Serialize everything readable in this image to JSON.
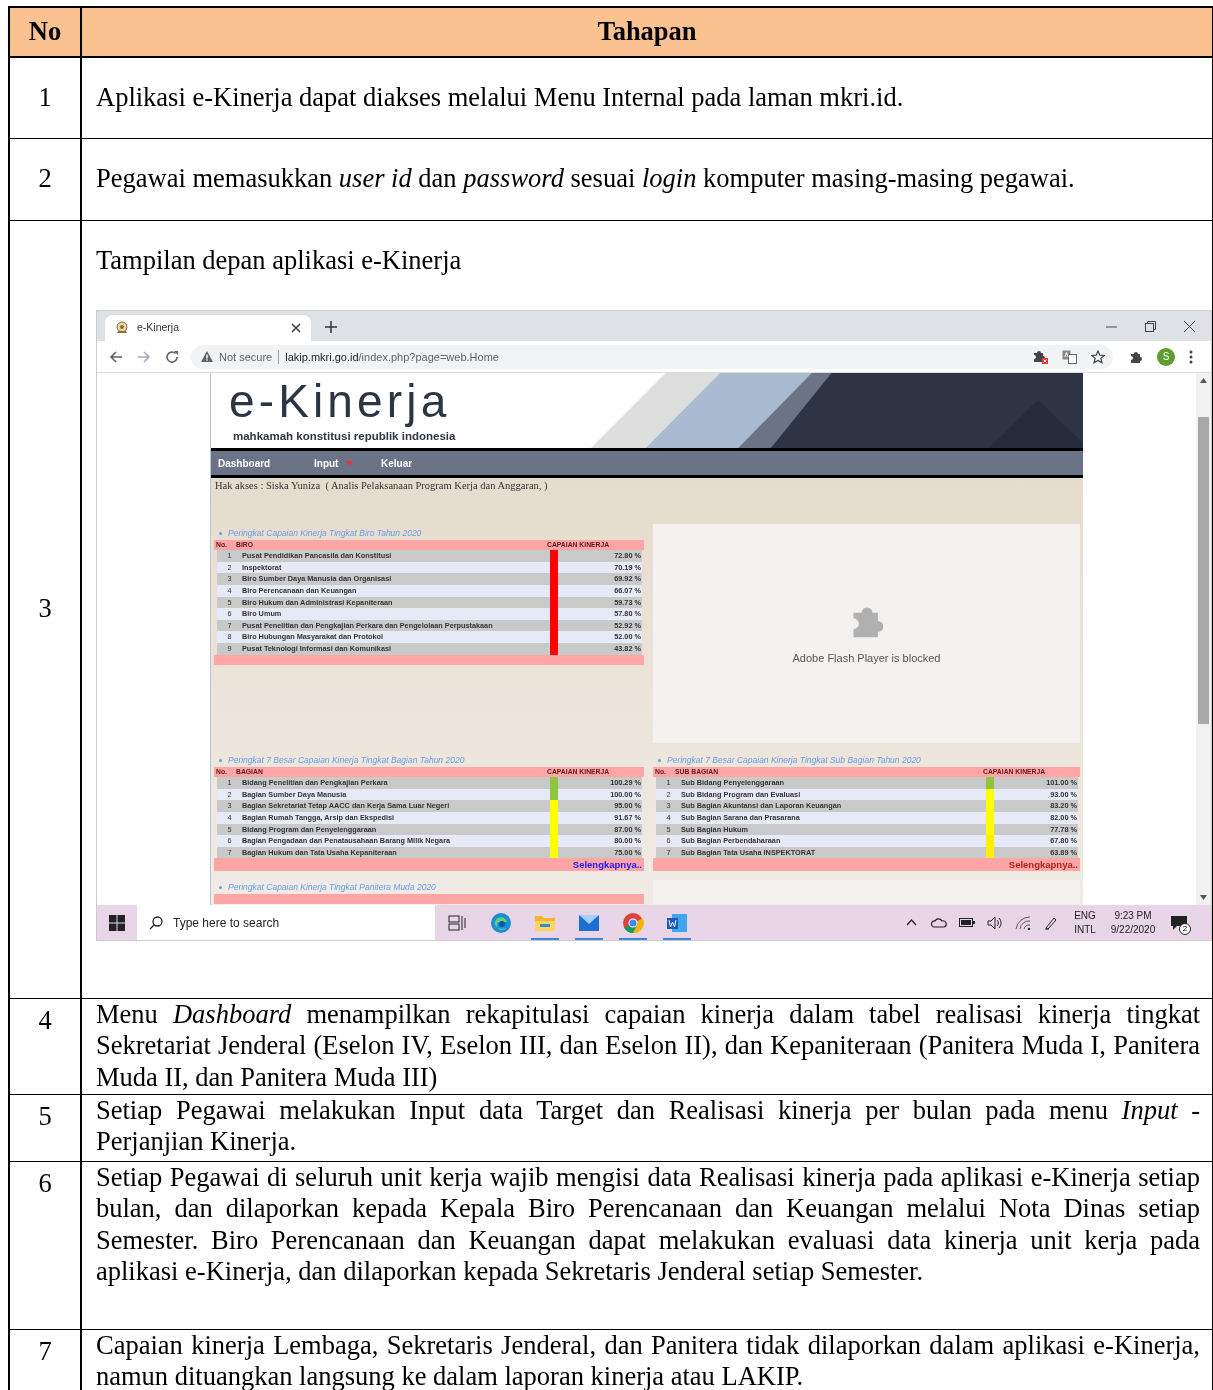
{
  "table": {
    "columns": [
      "No",
      "Tahapan"
    ],
    "rows": [
      {
        "no": "1",
        "text": "Aplikasi e-Kinerja dapat diakses melalui Menu Internal pada laman mkri.id."
      },
      {
        "no": "2",
        "text": "Pegawai memasukkan *user id* dan *password* sesuai *login* komputer masing-masing pegawai."
      },
      {
        "no": "3",
        "text": "Tampilan depan aplikasi e-Kinerja",
        "screenshot": {
          "browser": {
            "tab_title": "e-Kinerja",
            "security": "Not secure",
            "url_host": "lakip.mkri.go.id",
            "url_path": "/index.php?page=web.Home",
            "profile": "S"
          },
          "page": {
            "logo": "e-Kinerja",
            "subtitle": "mahkamah konstitusi republik indonesia",
            "nav": [
              {
                "label": "Dashboard",
                "has_menu": false
              },
              {
                "label": "Input",
                "has_menu": true
              },
              {
                "label": "Keluar",
                "has_menu": false
              }
            ],
            "access": "Hak akses : Siska Yuniza  ( Analis Pelaksanaan Program Kerja dan Anggaran, )",
            "panels": [
              {
                "title": "Peringkat Capaian Kinerja Tingkat Biro Tahun 2020",
                "columns": [
                  "No.",
                  "BIRO",
                  "CAPAIAN KINERJA"
                ],
                "rows": [
                  {
                    "no": "1",
                    "name": "Pusat Pendidikan Pancasila dan Konstitusi",
                    "value": "72.80 %",
                    "color": "#ff0000"
                  },
                  {
                    "no": "2",
                    "name": "Inspektorat",
                    "value": "70.19 %",
                    "color": "#ff0000"
                  },
                  {
                    "no": "3",
                    "name": "Biro Sumber Daya Manusia dan Organisasi",
                    "value": "69.92 %",
                    "color": "#ff0000"
                  },
                  {
                    "no": "4",
                    "name": "Biro Perencanaan dan Keuangan",
                    "value": "66.07 %",
                    "color": "#ff0000"
                  },
                  {
                    "no": "5",
                    "name": "Biro Hukum dan Administrasi Kepaniteraan",
                    "value": "59.73 %",
                    "color": "#ff0000"
                  },
                  {
                    "no": "6",
                    "name": "Biro Umum",
                    "value": "57.80 %",
                    "color": "#ff0000"
                  },
                  {
                    "no": "7",
                    "name": "Pusat Penelitian dan Pengkajian Perkara dan Pengelolaan Perpustakaan",
                    "value": "52.92 %",
                    "color": "#ff0000"
                  },
                  {
                    "no": "8",
                    "name": "Biro Hubungan Masyarakat dan Protokol",
                    "value": "52.00 %",
                    "color": "#ff0000"
                  },
                  {
                    "no": "9",
                    "name": "Pusat Teknologi Informasi dan Komunikasi",
                    "value": "43.82 %",
                    "color": "#ff0000"
                  }
                ]
              },
              {
                "title": "Peringkat 7 Besar Capaian Kinerja Tingkat Bagian Tahun 2020",
                "columns": [
                  "No.",
                  "BAGIAN",
                  "CAPAIAN KINERJA"
                ],
                "rows": [
                  {
                    "no": "1",
                    "name": "Bidang Penelitian dan Pengkajian Perkara",
                    "value": "100.29 %",
                    "color": "#8dc63f"
                  },
                  {
                    "no": "2",
                    "name": "Bagian Sumber Daya Manusia",
                    "value": "100.00 %",
                    "color": "#8dc63f"
                  },
                  {
                    "no": "3",
                    "name": "Bagian Sekretariat Tetap AACC dan Kerja Sama Luar Negeri",
                    "value": "95.00 %",
                    "color": "#ffff00"
                  },
                  {
                    "no": "4",
                    "name": "Bagian Rumah Tangga, Arsip dan Ekspedisi",
                    "value": "91.67 %",
                    "color": "#ffff00"
                  },
                  {
                    "no": "5",
                    "name": "Bidang Program dan Penyelenggaraan",
                    "value": "87.00 %",
                    "color": "#ffff00"
                  },
                  {
                    "no": "6",
                    "name": "Bagian Pengadaan dan Penatausahaan Barang Milik Negara",
                    "value": "80.00 %",
                    "color": "#ffff00"
                  },
                  {
                    "no": "7",
                    "name": "Bagian Hukum dan Tata Usaha Kepaniteraan",
                    "value": "75.00 %",
                    "color": "#ffff00"
                  }
                ],
                "more": {
                  "label": "Selengkapnya.."
                }
              },
              {
                "title": "Peringkat 7 Besar Capaian Kinerja Tingkat Sub Bagian Tahun 2020",
                "columns": [
                  "No.",
                  "SUB BAGIAN",
                  "CAPAIAN KINERJA"
                ],
                "rows": [
                  {
                    "no": "1",
                    "name": "Sub Bidang Penyelenggaraan",
                    "value": "101.00 %",
                    "color": "#8dc63f"
                  },
                  {
                    "no": "2",
                    "name": "Sub Bidang Program dan Evaluasi",
                    "value": "93.00 %",
                    "color": "#ffff00"
                  },
                  {
                    "no": "3",
                    "name": "Sub Bagian Akuntansi dan Laporan Keuangan",
                    "value": "83.20 %",
                    "color": "#ffff00"
                  },
                  {
                    "no": "4",
                    "name": "Sub Bagian Sarana dan Prasarana",
                    "value": "82.00 %",
                    "color": "#ffff00"
                  },
                  {
                    "no": "5",
                    "name": "Sub Bagian Hukum",
                    "value": "77.78 %",
                    "color": "#ffff00"
                  },
                  {
                    "no": "6",
                    "name": "Sub Bagian Perbendaharaan",
                    "value": "67.80 %",
                    "color": "#ffee00"
                  },
                  {
                    "no": "7",
                    "name": "Sub Bagian Tata Usaha INSPEKTORAT",
                    "value": "63.89 %",
                    "color": "#ffee00"
                  }
                ],
                "more": {
                  "label": "Selengkapnya.."
                }
              }
            ],
            "flash": "Adobe Flash Player is blocked",
            "next_title": "Peringkat Capaian Kinerja Tingkat Panitera Muda 2020"
          },
          "taskbar": {
            "search_placeholder": "Type here to search",
            "language": "ENG",
            "layout": "INTL",
            "time": "9:23 PM",
            "date": "9/22/2020",
            "notifications": "2"
          }
        }
      },
      {
        "no": "4",
        "text": "Menu *Dashboard* menampilkan rekapitulasi capaian kinerja dalam tabel realisasi kinerja tingkat Sekretariat Jenderal (Eselon IV, Eselon III, dan Eselon II), dan Kepaniteraan (Panitera Muda I, Panitera Muda II, dan Panitera Muda III)"
      },
      {
        "no": "5",
        "text": "Setiap Pegawai melakukan Input data Target dan Realisasi kinerja per bulan pada menu *Input* - Perjanjian Kinerja."
      },
      {
        "no": "6",
        "text": "Setiap Pegawai di seluruh unit kerja wajib mengisi data Realisasi kinerja pada aplikasi e-Kinerja setiap bulan, dan dilaporkan kepada Kepala Biro Perencanaan dan Keuangan melalui Nota Dinas setiap Semester. Biro Perencanaan dan Keuangan dapat melakukan evaluasi data kinerja unit kerja pada aplikasi e-Kinerja, dan dilaporkan kepada Sekretaris Jenderal setiap Semester."
      },
      {
        "no": "7",
        "text": "Capaian kinerja Lembaga, Sekretaris Jenderal, dan Panitera tidak dilaporkan dalam aplikasi e-Kinerja, namun dituangkan langsung ke dalam laporan kinerja atau LAKIP."
      }
    ]
  }
}
